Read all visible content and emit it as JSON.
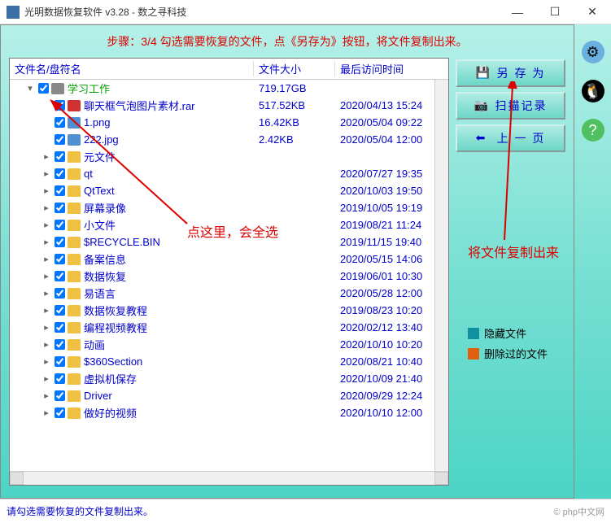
{
  "title": "光明数据恢复软件 v3.28 - 数之寻科技",
  "instruction": "步骤：3/4 勾选需要恢复的文件，点《另存为》按钮，将文件复制出来。",
  "headers": {
    "name": "文件名/盘符名",
    "size": "文件大小",
    "date": "最后访问时间"
  },
  "buttons": {
    "saveAs": "另 存 为",
    "scanLog": "扫描记录",
    "prevPage": "上 一 页"
  },
  "annotations": {
    "selectAll": "点这里，会全选",
    "copyOut": "将文件复制出来"
  },
  "legend": {
    "hidden": "隐藏文件",
    "deleted": "删除过的文件"
  },
  "status": "请勾选需要恢复的文件复制出来。",
  "brand": "© php中文网",
  "rows": [
    {
      "indent": 1,
      "expander": "▾",
      "chk": true,
      "icon": "disk",
      "name": "学习工作",
      "nameClass": "green",
      "size": "719.17GB",
      "date": ""
    },
    {
      "indent": 2,
      "expander": "",
      "chk": true,
      "icon": "rar",
      "name": "聊天框气泡图片素材.rar",
      "size": "517.52KB",
      "date": "2020/04/13 15:24"
    },
    {
      "indent": 2,
      "expander": "",
      "chk": true,
      "icon": "file",
      "name": "1.png",
      "size": "16.42KB",
      "date": "2020/05/04 09:22"
    },
    {
      "indent": 2,
      "expander": "",
      "chk": true,
      "icon": "file",
      "name": "222.jpg",
      "size": "2.42KB",
      "date": "2020/05/04 12:00"
    },
    {
      "indent": 2,
      "expander": "▸",
      "chk": true,
      "icon": "folder",
      "name": "元文件",
      "size": "",
      "date": ""
    },
    {
      "indent": 2,
      "expander": "▸",
      "chk": true,
      "icon": "folder",
      "name": "qt",
      "size": "",
      "date": "2020/07/27 19:35"
    },
    {
      "indent": 2,
      "expander": "▸",
      "chk": true,
      "icon": "folder",
      "name": "QtText",
      "size": "",
      "date": "2020/10/03 19:50"
    },
    {
      "indent": 2,
      "expander": "▸",
      "chk": true,
      "icon": "folder",
      "name": "屏幕录像",
      "size": "",
      "date": "2019/10/05 19:19"
    },
    {
      "indent": 2,
      "expander": "▸",
      "chk": true,
      "icon": "folder",
      "name": "小文件",
      "size": "",
      "date": "2019/08/21 11:24"
    },
    {
      "indent": 2,
      "expander": "▸",
      "chk": true,
      "icon": "folder",
      "name": "$RECYCLE.BIN",
      "size": "",
      "date": "2019/11/15 19:40"
    },
    {
      "indent": 2,
      "expander": "▸",
      "chk": true,
      "icon": "folder",
      "name": "备案信息",
      "size": "",
      "date": "2020/05/15 14:06"
    },
    {
      "indent": 2,
      "expander": "▸",
      "chk": true,
      "icon": "folder",
      "name": "数据恢复",
      "size": "",
      "date": "2019/06/01 10:30"
    },
    {
      "indent": 2,
      "expander": "▸",
      "chk": true,
      "icon": "folder",
      "name": "易语言",
      "size": "",
      "date": "2020/05/28 12:00"
    },
    {
      "indent": 2,
      "expander": "▸",
      "chk": true,
      "icon": "folder",
      "name": "数据恢复教程",
      "size": "",
      "date": "2019/08/23 10:20"
    },
    {
      "indent": 2,
      "expander": "▸",
      "chk": true,
      "icon": "folder",
      "name": "编程视频教程",
      "size": "",
      "date": "2020/02/12 13:40"
    },
    {
      "indent": 2,
      "expander": "▸",
      "chk": true,
      "icon": "folder",
      "name": "动画",
      "size": "",
      "date": "2020/10/10 10:20"
    },
    {
      "indent": 2,
      "expander": "▸",
      "chk": true,
      "icon": "folder",
      "name": "$360Section",
      "size": "",
      "date": "2020/08/21 10:40"
    },
    {
      "indent": 2,
      "expander": "▸",
      "chk": true,
      "icon": "folder",
      "name": "虚拟机保存",
      "size": "",
      "date": "2020/10/09 21:40"
    },
    {
      "indent": 2,
      "expander": "▸",
      "chk": true,
      "icon": "folder",
      "name": "Driver",
      "size": "",
      "date": "2020/09/29 12:24"
    },
    {
      "indent": 2,
      "expander": "▸",
      "chk": true,
      "icon": "folder",
      "name": "做好的视频",
      "size": "",
      "date": "2020/10/10 12:00"
    }
  ]
}
